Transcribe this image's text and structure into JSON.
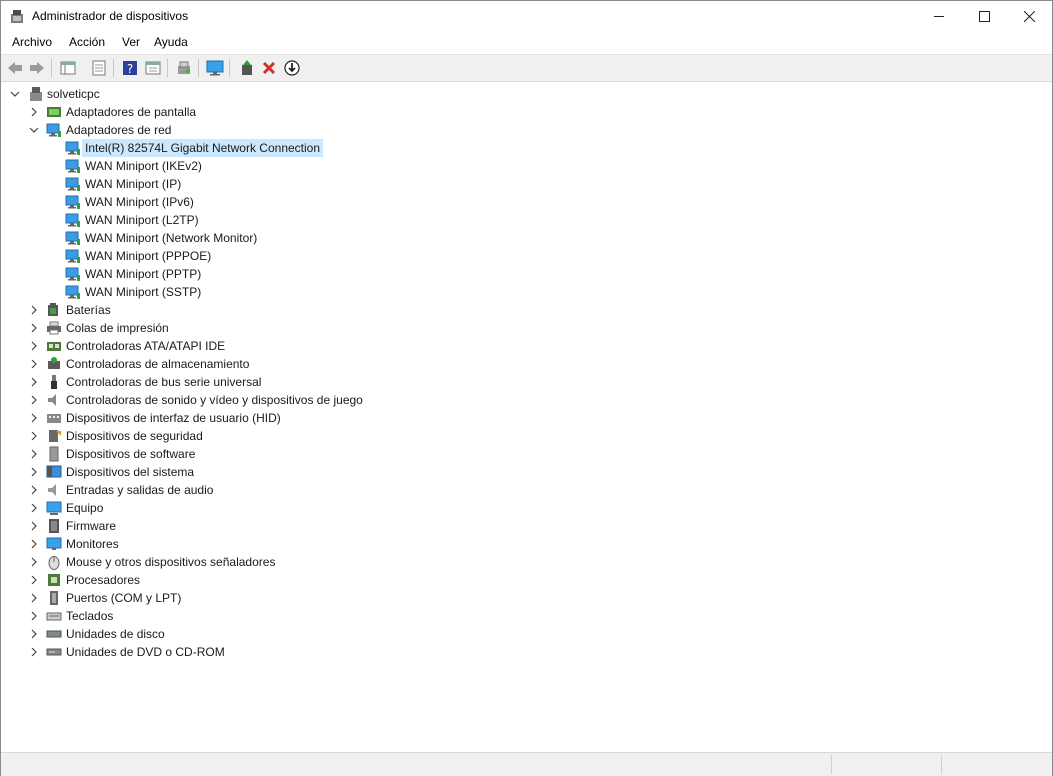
{
  "window": {
    "title": "Administrador de dispositivos"
  },
  "menubar": {
    "items": [
      "Archivo",
      "Acción",
      "Ver",
      "Ayuda"
    ]
  },
  "toolbar": {
    "buttons": [
      "back-icon",
      "forward-icon",
      "properties-window-icon",
      "properties-icon",
      "help-icon",
      "list-icon",
      "scan-hardware-icon",
      "monitor-icon",
      "update-driver-icon",
      "uninstall-icon",
      "download-icon"
    ]
  },
  "tree": {
    "root": "solveticpc",
    "categories": [
      {
        "label": "Adaptadores de pantalla",
        "icon": "display-adapter-icon",
        "expanded": false
      },
      {
        "label": "Adaptadores de red",
        "icon": "network-adapter-icon",
        "expanded": true,
        "children": [
          "Intel(R) 82574L Gigabit Network Connection",
          "WAN Miniport (IKEv2)",
          "WAN Miniport (IP)",
          "WAN Miniport (IPv6)",
          "WAN Miniport (L2TP)",
          "WAN Miniport (Network Monitor)",
          "WAN Miniport (PPPOE)",
          "WAN Miniport (PPTP)",
          "WAN Miniport (SSTP)"
        ]
      },
      {
        "label": "Baterías",
        "icon": "battery-icon",
        "expanded": false
      },
      {
        "label": "Colas de impresión",
        "icon": "printer-icon",
        "expanded": false
      },
      {
        "label": "Controladoras ATA/ATAPI IDE",
        "icon": "ide-controller-icon",
        "expanded": false
      },
      {
        "label": "Controladoras de almacenamiento",
        "icon": "storage-controller-icon",
        "expanded": false
      },
      {
        "label": "Controladoras de bus serie universal",
        "icon": "usb-icon",
        "expanded": false
      },
      {
        "label": "Controladoras de sonido y vídeo y dispositivos de juego",
        "icon": "sound-icon",
        "expanded": false
      },
      {
        "label": "Dispositivos de interfaz de usuario (HID)",
        "icon": "hid-icon",
        "expanded": false
      },
      {
        "label": "Dispositivos de seguridad",
        "icon": "security-device-icon",
        "expanded": false
      },
      {
        "label": "Dispositivos de software",
        "icon": "software-device-icon",
        "expanded": false
      },
      {
        "label": "Dispositivos del sistema",
        "icon": "system-device-icon",
        "expanded": false
      },
      {
        "label": "Entradas y salidas de audio",
        "icon": "audio-io-icon",
        "expanded": false
      },
      {
        "label": "Equipo",
        "icon": "computer-icon",
        "expanded": false
      },
      {
        "label": "Firmware",
        "icon": "firmware-icon",
        "expanded": false
      },
      {
        "label": "Monitores",
        "icon": "monitor-icon",
        "expanded": false
      },
      {
        "label": "Mouse y otros dispositivos señaladores",
        "icon": "mouse-icon",
        "expanded": false
      },
      {
        "label": "Procesadores",
        "icon": "processor-icon",
        "expanded": false
      },
      {
        "label": "Puertos (COM y LPT)",
        "icon": "port-icon",
        "expanded": false
      },
      {
        "label": "Teclados",
        "icon": "keyboard-icon",
        "expanded": false
      },
      {
        "label": "Unidades de disco",
        "icon": "disk-drive-icon",
        "expanded": false
      },
      {
        "label": "Unidades de DVD o CD-ROM",
        "icon": "dvd-drive-icon",
        "expanded": false
      }
    ]
  },
  "colors": {
    "selection": "#cce8ff",
    "network": "#2b8fd8",
    "toolbar_bg": "#f0f0f0"
  }
}
